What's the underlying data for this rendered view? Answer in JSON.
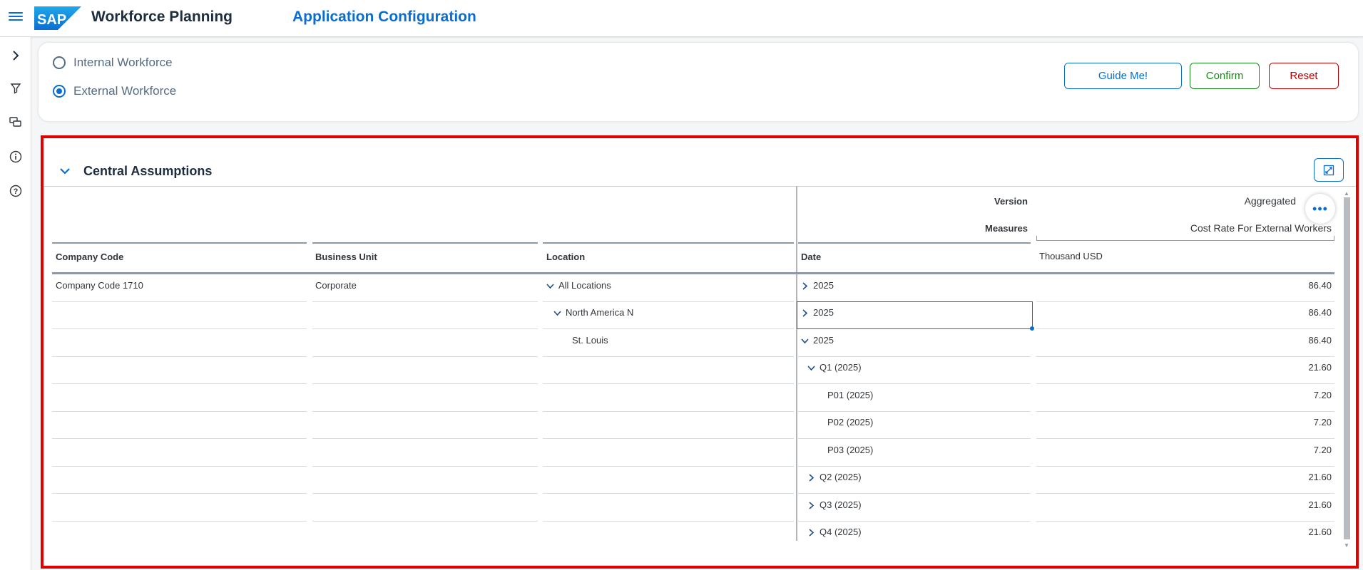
{
  "shell": {
    "logo_text": "SAP",
    "app_title": "Workforce Planning",
    "page_title": "Application Configuration"
  },
  "sidenav": {
    "icons": [
      "chevron-right-icon",
      "filter-icon",
      "comments-icon",
      "info-icon",
      "help-icon"
    ]
  },
  "workforce": {
    "options": [
      {
        "label": "Internal Workforce",
        "selected": false
      },
      {
        "label": "External Workforce",
        "selected": true
      }
    ]
  },
  "buttons": {
    "guide": "Guide Me!",
    "confirm": "Confirm",
    "reset": "Reset"
  },
  "section": {
    "title": "Central Assumptions"
  },
  "table": {
    "version_label": "Version",
    "version_value": "Aggregated",
    "measures_label": "Measures",
    "measures_value": "Cost Rate For External Workers",
    "columns": {
      "company_code": "Company Code",
      "business_unit": "Business Unit",
      "location": "Location",
      "date": "Date",
      "unit": "Thousand USD"
    },
    "dims": {
      "company_code": "Company Code 1710",
      "business_unit": "Corporate",
      "loc_all": "All Locations",
      "loc_na": "North America N",
      "loc_stl": "St. Louis"
    },
    "rows": [
      {
        "date": "2025",
        "value": "86.40"
      },
      {
        "date": "2025",
        "value": "86.40"
      },
      {
        "date": "2025",
        "value": "86.40"
      },
      {
        "date": "Q1 (2025)",
        "value": "21.60"
      },
      {
        "date": "P01 (2025)",
        "value": "7.20"
      },
      {
        "date": "P02 (2025)",
        "value": "7.20"
      },
      {
        "date": "P03 (2025)",
        "value": "7.20"
      },
      {
        "date": "Q2 (2025)",
        "value": "21.60"
      },
      {
        "date": "Q3 (2025)",
        "value": "21.60"
      },
      {
        "date": "Q4 (2025)",
        "value": "21.60"
      }
    ]
  }
}
